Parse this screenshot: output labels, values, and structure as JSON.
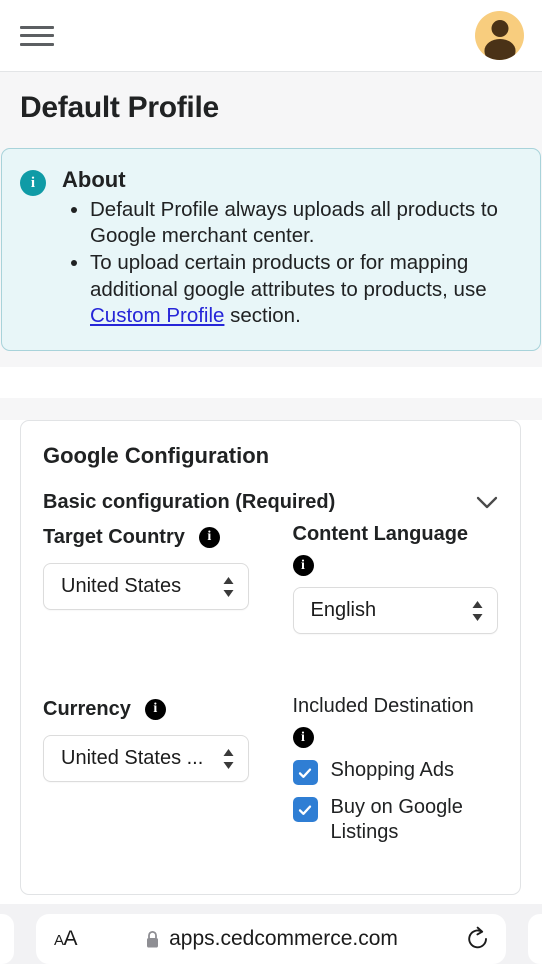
{
  "appbar": {
    "menu_icon": "hamburger-menu-icon",
    "avatar_icon": "user-avatar-icon"
  },
  "header": {
    "title": "Default Profile"
  },
  "banner": {
    "icon": "info-circle-icon",
    "icon_char": "i",
    "title": "About",
    "bullets": [
      {
        "text_before": "Default Profile always uploads all products to Google merchant center.",
        "link": "",
        "text_after": ""
      },
      {
        "text_before": "To upload certain products or for mapping additional google attributes to products, use ",
        "link": "Custom Profile",
        "text_after": " section."
      }
    ],
    "accent_color": "#0f9ba6",
    "background_color": "#e8f6f8",
    "link_color": "#2626d8"
  },
  "card": {
    "title": "Google Configuration",
    "section": {
      "label": "Basic configuration (Required)",
      "chevron_icon": "chevron-down-icon",
      "expanded": true
    },
    "fields": {
      "target_country": {
        "label": "Target Country",
        "info_icon": "info-dot-icon",
        "info_char": "i",
        "value": "United States",
        "stepper_icon": "stepper-updown-icon"
      },
      "content_language": {
        "label": "Content Language",
        "info_icon": "info-dot-icon",
        "info_char": "i",
        "value": "English",
        "stepper_icon": "stepper-updown-icon"
      },
      "currency": {
        "label": "Currency",
        "info_icon": "info-dot-icon",
        "info_char": "i",
        "value": "United States ...",
        "stepper_icon": "stepper-updown-icon"
      },
      "included_destination": {
        "label": "Included Destination",
        "info_icon": "info-dot-icon",
        "info_char": "i",
        "checkbox_color": "#2f7ed4",
        "options": [
          {
            "label": "Shopping Ads",
            "checked": true
          },
          {
            "label": "Buy on Google Listings",
            "checked": true
          }
        ]
      }
    }
  },
  "browser": {
    "text_size_label_small": "A",
    "text_size_label_large": "A",
    "lock_icon": "lock-icon",
    "url": "apps.cedcommerce.com",
    "reload_icon": "reload-icon"
  }
}
